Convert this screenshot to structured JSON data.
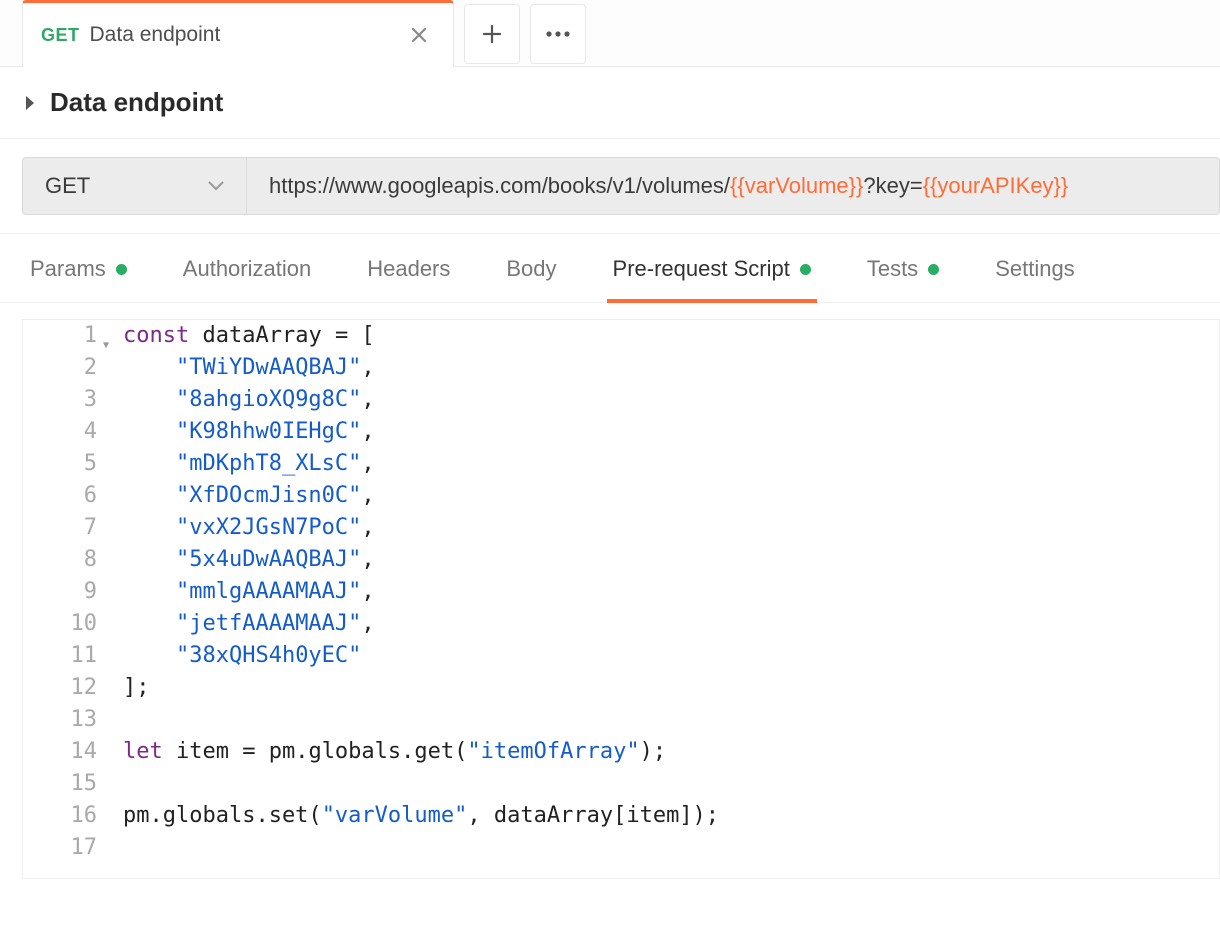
{
  "tabs": {
    "active": {
      "method": "GET",
      "title": "Data endpoint"
    }
  },
  "request": {
    "name": "Data endpoint",
    "method": "GET",
    "url_prefix": "https://www.googleapis.com/books/v1/volumes/",
    "url_var1": "{{varVolume}}",
    "url_mid": "?key=",
    "url_var2": "{{yourAPIKey}}"
  },
  "subtabs": {
    "params": "Params",
    "authorization": "Authorization",
    "headers": "Headers",
    "body": "Body",
    "prerequest": "Pre-request Script",
    "tests": "Tests",
    "settings": "Settings"
  },
  "code": {
    "kw_const": "const",
    "decl_name": " dataArray ",
    "eq_open": "= [",
    "arr": [
      "\"TWiYDwAAQBAJ\"",
      "\"8ahgioXQ9g8C\"",
      "\"K98hhw0IEHgC\"",
      "\"mDKphT8_XLsC\"",
      "\"XfDOcmJisn0C\"",
      "\"vxX2JGsN7PoC\"",
      "\"5x4uDwAAQBAJ\"",
      "\"mmlgAAAAMAAJ\"",
      "\"jetfAAAAMAAJ\"",
      "\"38xQHS4h0yEC\""
    ],
    "close": "];",
    "kw_let": "let",
    "let_line_mid": " item = pm.globals.get(",
    "let_str": "\"itemOfArray\"",
    "let_end": ");",
    "set_pre": "pm.globals.set(",
    "set_str": "\"varVolume\"",
    "set_mid": ", dataArray[item]);",
    "line_numbers": [
      "1",
      "2",
      "3",
      "4",
      "5",
      "6",
      "7",
      "8",
      "9",
      "10",
      "11",
      "12",
      "13",
      "14",
      "15",
      "16",
      "17"
    ]
  }
}
